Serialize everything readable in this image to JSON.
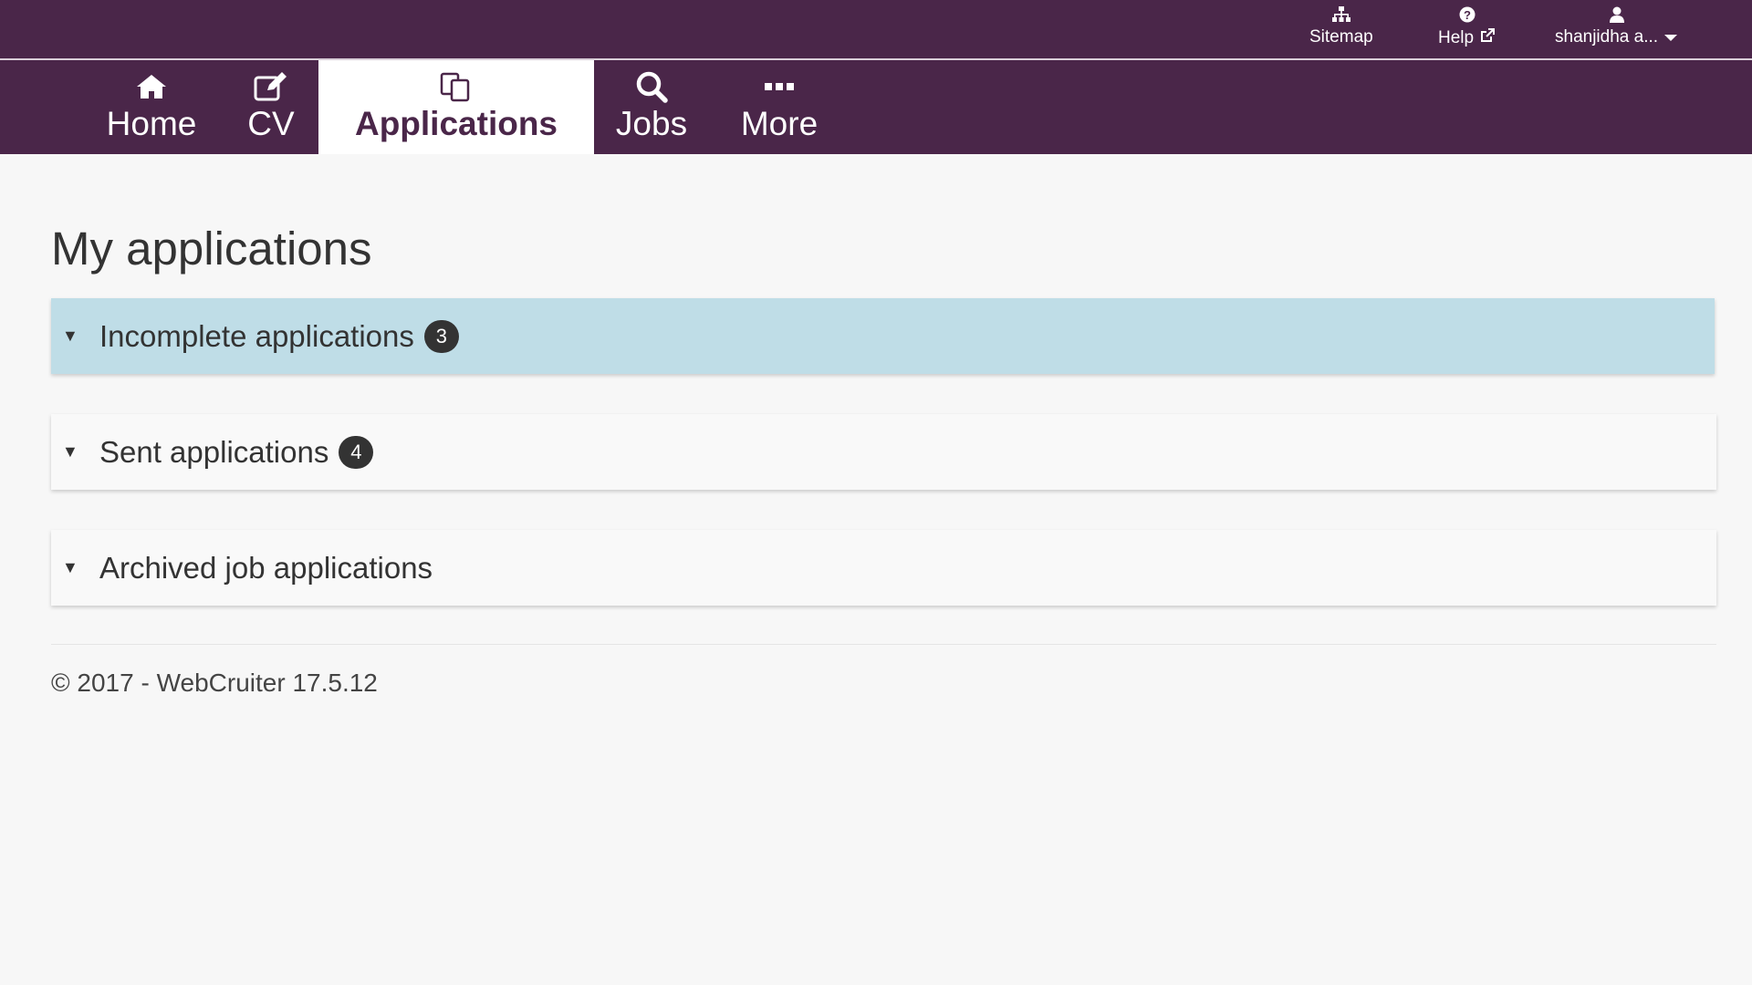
{
  "utility_bar": {
    "sitemap": {
      "label": "Sitemap",
      "icon": "sitemap-icon"
    },
    "help": {
      "label": "Help",
      "icon": "question-circle-icon",
      "external_icon": "external-link-icon"
    },
    "user": {
      "label": "shanjidha a...",
      "icon": "user-icon",
      "dropdown_icon": "caret-down-icon"
    }
  },
  "nav": {
    "items": [
      {
        "label": "Home",
        "icon": "home-icon",
        "active": false
      },
      {
        "label": "CV",
        "icon": "edit-icon",
        "active": false
      },
      {
        "label": "Applications",
        "icon": "copy-icon",
        "active": true
      },
      {
        "label": "Jobs",
        "icon": "search-icon",
        "active": false
      },
      {
        "label": "More",
        "icon": "ellipsis-icon",
        "active": false
      }
    ]
  },
  "main": {
    "title": "My applications",
    "panels": [
      {
        "title": "Incomplete applications",
        "count": "3",
        "expanded_highlight": true
      },
      {
        "title": "Sent applications",
        "count": "4",
        "expanded_highlight": false
      },
      {
        "title": "Archived job applications",
        "count": "",
        "expanded_highlight": false
      }
    ]
  },
  "footer": {
    "text": "© 2017 - WebCruiter 17.5.12"
  },
  "colors": {
    "brand": "#4a2649",
    "panel_highlight": "#bfdde7",
    "badge": "#333333",
    "background": "#f7f7f7"
  }
}
